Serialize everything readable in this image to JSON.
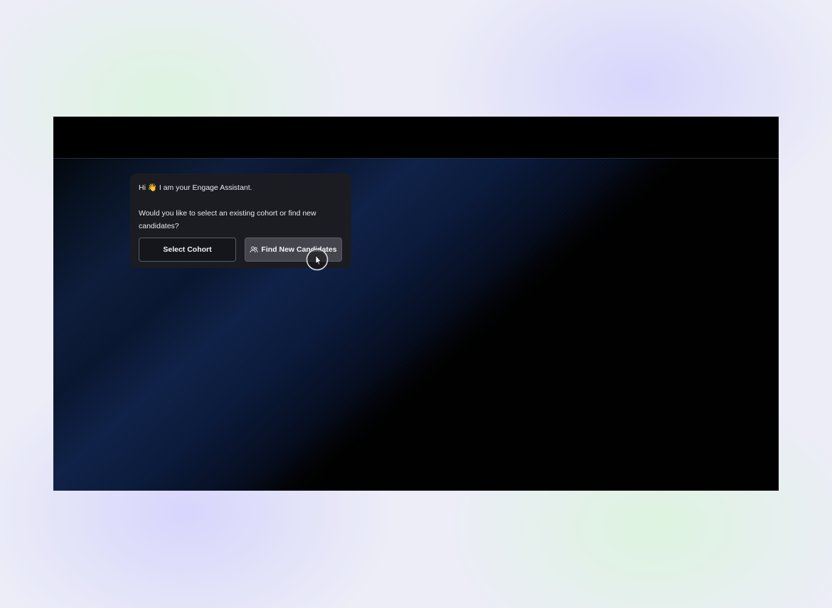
{
  "assistant": {
    "greeting_prefix": "Hi",
    "greeting_emoji": "👋",
    "greeting_text": "I am your Engage Assistant.",
    "question": "Would you like to select an existing cohort or find new candidates?"
  },
  "actions": {
    "select_cohort_label": "Select Cohort",
    "find_candidates_label": "Find New Candidates",
    "find_candidates_icon": "users-icon"
  },
  "colors": {
    "card_background": "#1b1c22",
    "button_outline_background": "#15161b",
    "button_filled_background": "#45464d",
    "page_backdrop": "#ecedf7"
  }
}
